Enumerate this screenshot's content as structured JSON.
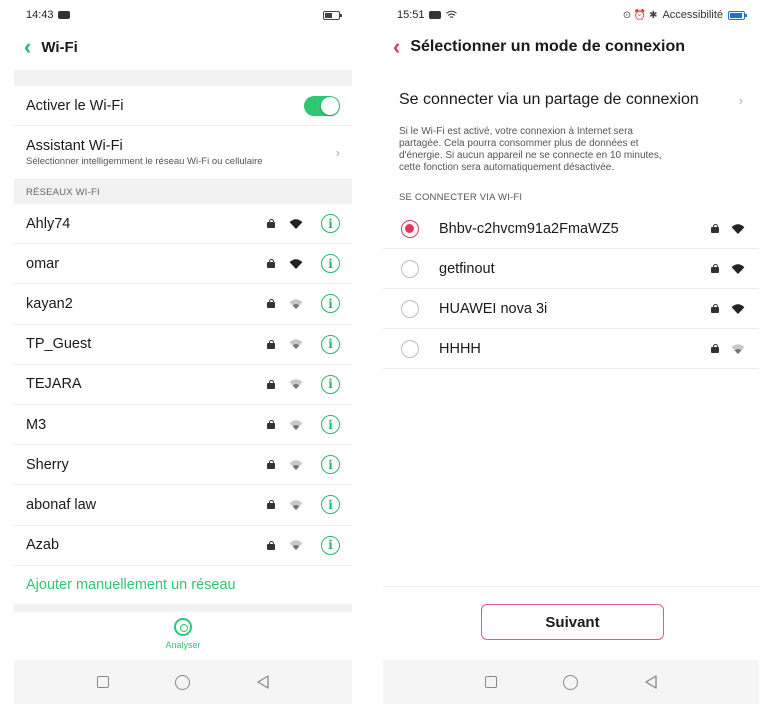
{
  "left": {
    "status": {
      "time": "14:43"
    },
    "title": "Wi-Fi",
    "wifi_toggle_label": "Activer le Wi-Fi",
    "wifi_enabled": true,
    "assistant": {
      "title": "Assistant Wi-Fi",
      "subtitle": "Sélectionner intelligemment le réseau Wi-Fi ou cellulaire"
    },
    "networks_header": "RÉSEAUX WI-FI",
    "networks": [
      {
        "name": "Ahly74",
        "signal": "strong"
      },
      {
        "name": "omar",
        "signal": "strong"
      },
      {
        "name": "kayan2",
        "signal": "weak"
      },
      {
        "name": "TP_Guest",
        "signal": "weak"
      },
      {
        "name": "TEJARA",
        "signal": "weak"
      },
      {
        "name": "M3",
        "signal": "weak"
      },
      {
        "name": "Sherry",
        "signal": "weak"
      },
      {
        "name": "abonaf law",
        "signal": "weak"
      },
      {
        "name": "Azab",
        "signal": "weak"
      }
    ],
    "add_network": "Ajouter manuellement un réseau",
    "analyse_label": "Analyser"
  },
  "right": {
    "status": {
      "time": "15:51",
      "right_text": "Accessibilité"
    },
    "title": "Sélectionner un mode de connexion",
    "hotspot_label": "Se connecter via un partage de connexion",
    "hotspot_desc_lines": [
      "Si le Wi-Fi est activé, votre connexion à Internet sera",
      "partagée. Cela pourra consommer plus de données et",
      "d'énergie. Si aucun appareil ne se connecte en 10 minutes,",
      "cette fonction sera automatiquement désactivée."
    ],
    "wifi_section": "SE CONNECTER VIA WI-FI",
    "networks": [
      {
        "name": "Bhbv-c2hvcm91a2FmaWZ5",
        "selected": true,
        "signal": "strong"
      },
      {
        "name": "getfinout",
        "selected": false,
        "signal": "strong"
      },
      {
        "name": "HUAWEI nova 3i",
        "selected": false,
        "signal": "strong"
      },
      {
        "name": "HHHH",
        "selected": false,
        "signal": "weak"
      }
    ],
    "next_button": "Suivant"
  },
  "colors": {
    "green_accent": "#2ec774",
    "pink_accent": "#e0395b",
    "button_border": "#e0559b"
  },
  "icons": {
    "lock": "lock-icon",
    "wifi": "wifi-icon",
    "info": "info-icon",
    "back": "chevron-left-icon",
    "analyse": "scan-icon"
  }
}
